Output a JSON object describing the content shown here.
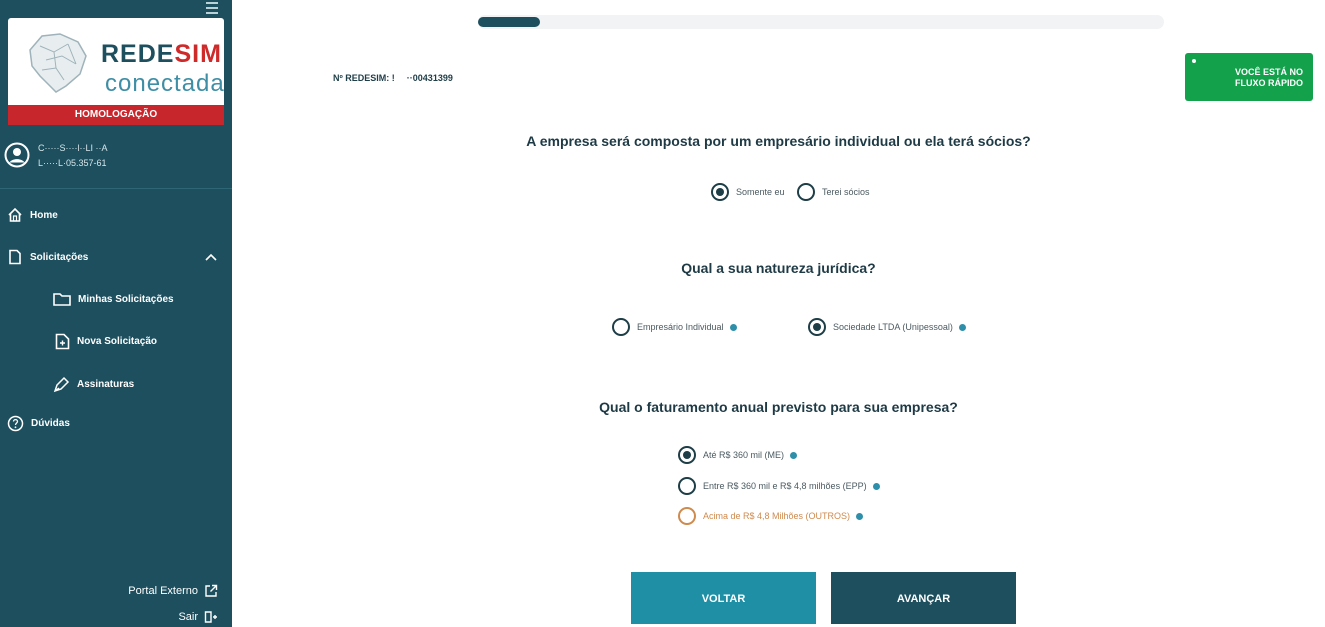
{
  "sidebar": {
    "logo": {
      "top": "REDE",
      "top_red": "SIM",
      "bottom": "conectada"
    },
    "environment": "HOMOLOGAÇÃO",
    "user": {
      "name": "C·····S····l··LI ··A",
      "document": "L·····L·05.357-61"
    },
    "nav": {
      "home": "Home",
      "solicitacoes": "Solicitações",
      "minhas": "Minhas Solicitações",
      "nova": "Nova Solicitação",
      "assinaturas": "Assinaturas",
      "duvidas": "Dúvidas"
    },
    "portal_externo": "Portal Externo",
    "sair": "Sair"
  },
  "header": {
    "redesim_label": "Nº REDESIM: !",
    "redesim_value": "··00431399",
    "progress_fraction": 0.09,
    "badge_line1": "VOCÊ ESTÁ NO",
    "badge_line2": "FLUXO RÁPIDO"
  },
  "q1": {
    "question": "A empresa será composta por um empresário individual ou ela terá sócios?",
    "opt1": "Somente eu",
    "opt2": "Terei sócios"
  },
  "q2": {
    "question": "Qual a sua natureza jurídica?",
    "opt1": "Empresário Individual",
    "opt2": "Sociedade LTDA (Unipessoal)"
  },
  "q3": {
    "question": "Qual o faturamento anual previsto para sua empresa?",
    "opt1": "Até R$ 360 mil (ME)",
    "opt2": "Entre R$ 360 mil e R$ 4,8 milhões (EPP)",
    "opt3": "Acima de R$ 4,8 Milhões (OUTROS)"
  },
  "buttons": {
    "back": "VOLTAR",
    "next": "AVANÇAR"
  },
  "colors": {
    "sidebar": "#1d4f5f",
    "accent": "#1f8fa6",
    "badge": "#13a14c",
    "alert": "#c8262d",
    "warning": "#cf8a4e"
  }
}
